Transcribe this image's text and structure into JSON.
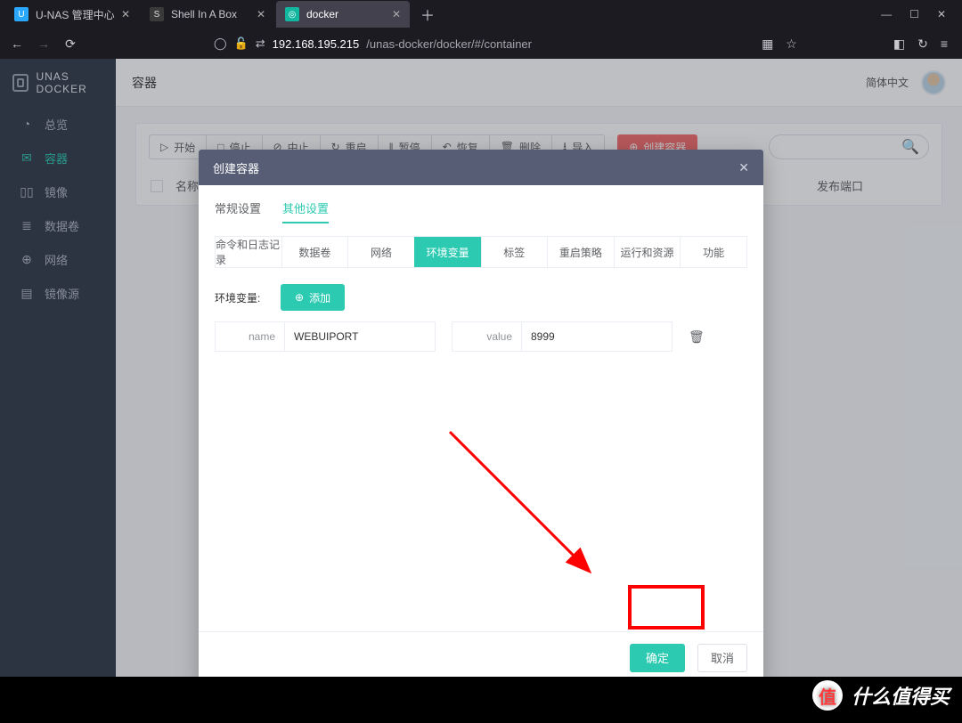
{
  "browser": {
    "tabs": [
      {
        "title": "U-NAS 管理中心",
        "favicon_bg": "#2aa7ff",
        "favicon_txt": "U",
        "active": false
      },
      {
        "title": "Shell In A Box",
        "favicon_bg": "#444",
        "favicon_txt": "S",
        "active": false
      },
      {
        "title": "docker",
        "favicon_bg": "#1ec8b0",
        "favicon_txt": "◎",
        "active": true
      }
    ],
    "url_display": {
      "prefix": "192.168.195.215",
      "path": "/unas-docker/docker/#/container"
    }
  },
  "app": {
    "brand": "UNAS DOCKER",
    "lang": "简体中文",
    "topbar_title": "容器",
    "sidebar": {
      "items": [
        {
          "icon": "◔",
          "label": "总览"
        },
        {
          "icon": "✉",
          "label": "容器",
          "active": true
        },
        {
          "icon": "⬛⬛",
          "label": "镜像"
        },
        {
          "icon": "≣",
          "label": "数据卷"
        },
        {
          "icon": "⊕",
          "label": "网络"
        },
        {
          "icon": "▤",
          "label": "镜像源"
        }
      ]
    },
    "toolbar": {
      "start": "开始",
      "stop": "停止",
      "abort": "中止",
      "restart": "重启",
      "pause": "暂停",
      "resume": "恢复",
      "delete": "删除",
      "import": "导入",
      "create": "创建容器"
    },
    "table": {
      "col_name": "名称",
      "col_port": "发布端口"
    }
  },
  "dialog": {
    "title": "创建容器",
    "top_tabs": {
      "general": "常规设置",
      "other": "其他设置"
    },
    "active_top_tab": "other",
    "sub_tabs": {
      "cmdlog": "命令和日志记录",
      "volumes": "数据卷",
      "network": "网络",
      "env": "环境变量",
      "labels": "标签",
      "restart": "重启策略",
      "runtime": "运行和资源",
      "caps": "功能"
    },
    "active_sub_tab": "env",
    "env_section": {
      "label": "环境变量:",
      "add_btn": "添加",
      "name_label": "name",
      "value_label": "value",
      "name_value": "WEBUIPORT",
      "value_value": "8999"
    },
    "ok": "确定",
    "cancel": "取消"
  },
  "watermark": "什么值得买"
}
